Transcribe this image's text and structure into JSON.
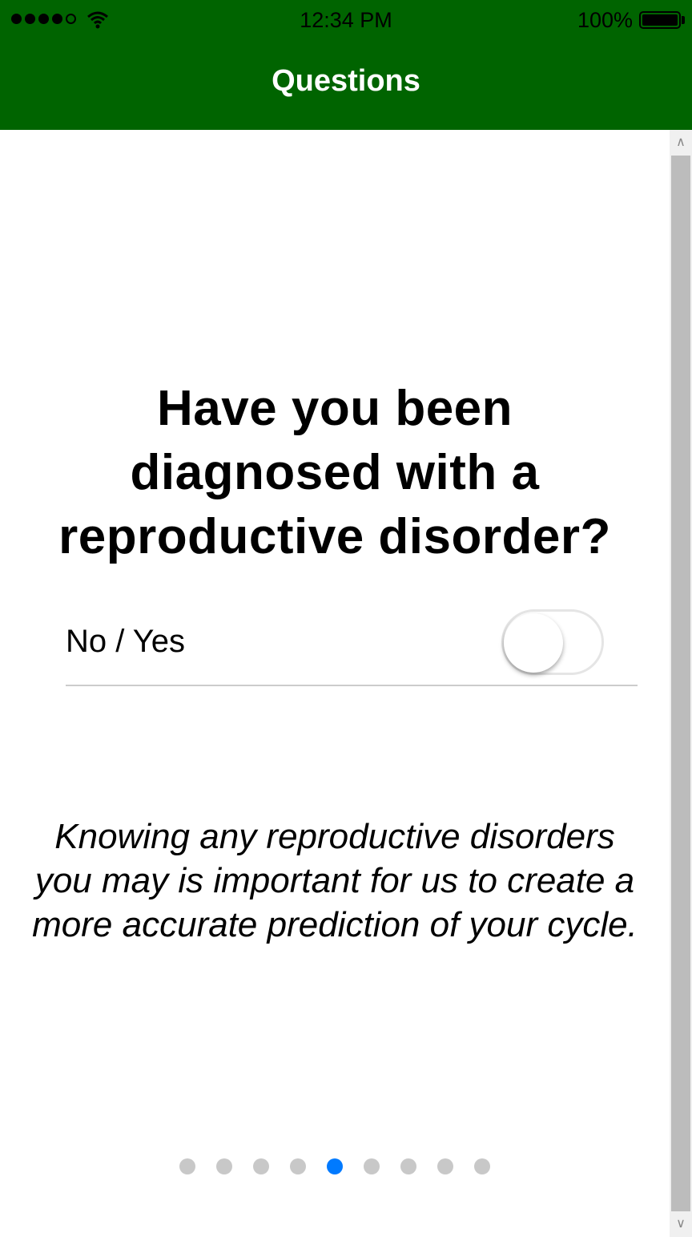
{
  "status_bar": {
    "time": "12:34 PM",
    "battery": "100%",
    "signal_icon": "signal-dots-icon",
    "wifi_icon": "wifi-icon",
    "battery_icon": "battery-icon"
  },
  "header": {
    "title": "Questions",
    "color": "#006400"
  },
  "question": {
    "text": "Have you been diagnosed with a reproductive disorder?"
  },
  "toggle": {
    "label": "No / Yes",
    "value": false
  },
  "explanation": {
    "text": "Knowing any reproductive disorders you may is important for us to create a more accurate prediction of your cycle."
  },
  "pager": {
    "total": 9,
    "active_index": 4,
    "active_color": "#007aff"
  },
  "scrollbar": {
    "up_glyph": "∧",
    "down_glyph": "∨"
  }
}
